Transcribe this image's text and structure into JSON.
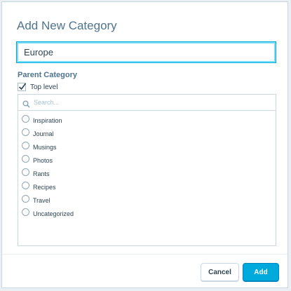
{
  "dialog": {
    "title": "Add New Category",
    "name_value": "Europe",
    "parent_label": "Parent Category",
    "top_level": {
      "label": "Top level",
      "checked": true
    },
    "search": {
      "placeholder": "Search...",
      "icon": "search-icon"
    },
    "categories": [
      {
        "label": "Inspiration",
        "selected": false
      },
      {
        "label": "Journal",
        "selected": false
      },
      {
        "label": "Musings",
        "selected": false
      },
      {
        "label": "Photos",
        "selected": false
      },
      {
        "label": "Rants",
        "selected": false
      },
      {
        "label": "Recipes",
        "selected": false
      },
      {
        "label": "Travel",
        "selected": false
      },
      {
        "label": "Uncategorized",
        "selected": false
      }
    ]
  },
  "footer": {
    "cancel_label": "Cancel",
    "add_label": "Add"
  },
  "colors": {
    "accent": "#00aadc",
    "focus_border": "#78dcfa",
    "title_text": "#4f748e",
    "body_text": "#2e4453",
    "border": "#c8d7e1"
  }
}
